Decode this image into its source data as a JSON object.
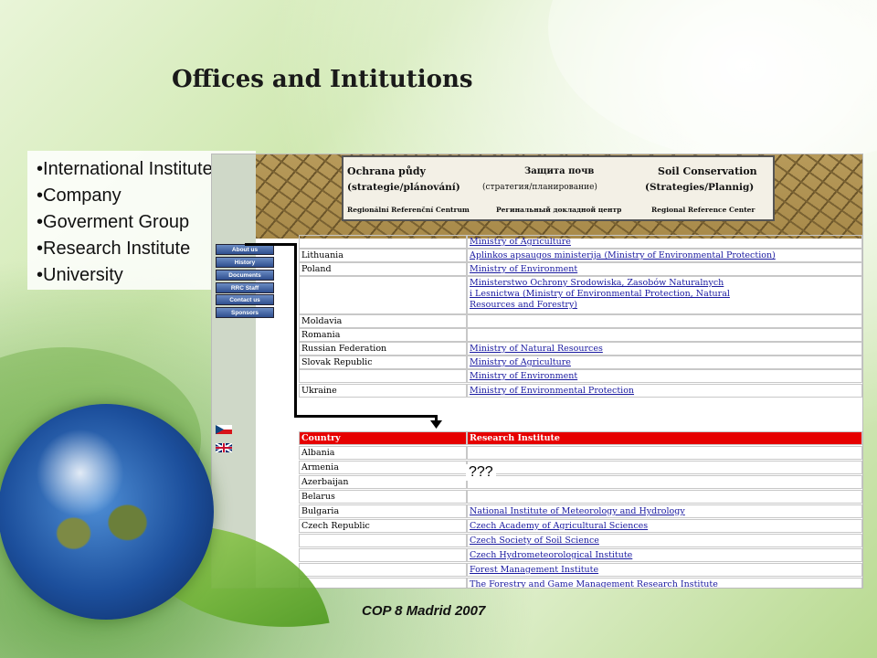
{
  "slide": {
    "title": "Offices and Intitutions",
    "bullets": [
      "International Institute",
      "Company",
      "Goverment Group",
      "Research Institute",
      "University"
    ],
    "footer": "COP 8 Madrid 2007",
    "question": "???"
  },
  "banner": {
    "cz_title": "Ochrana půdy",
    "cz_sub": "(strategie/plánování)",
    "cz_center": "Regionální Referenční Centrum",
    "ru_title": "Защита почв",
    "ru_sub": "(стратегия/планирование)",
    "ru_center": "Регинальный докладной центр",
    "en_title": "Soil Conservation",
    "en_sub": "(Strategies/Plannig)",
    "en_center": "Regional Reference Center"
  },
  "nav": [
    "About us",
    "History",
    "Documents",
    "RRC Staff",
    "Contact us",
    "Sponsors"
  ],
  "table1": {
    "rows": [
      {
        "country": "",
        "value": "Ministry of Agriculture"
      },
      {
        "country": "Lithuania",
        "value": "Aplinkos apsaugos ministerija (Ministry of Environmental Protection)"
      },
      {
        "country": "Poland",
        "value": "Ministry of Environment"
      },
      {
        "country": "",
        "value": "Ministerstwo Ochrony Srodowiska, Zasobów Naturalnych"
      },
      {
        "country": "",
        "value": "i Lesnictwa (Ministry of Environmental Protection, Natural"
      },
      {
        "country": "",
        "value": "Resources and Forestry)"
      },
      {
        "country": "Moldavia",
        "value": ""
      },
      {
        "country": "Romania",
        "value": ""
      },
      {
        "country": "Russian Federation",
        "value": "Ministry of Natural Resources"
      },
      {
        "country": "Slovak Republic",
        "value": "Ministry of Agriculture"
      },
      {
        "country": "",
        "value": "Ministry of  Environment"
      },
      {
        "country": "Ukraine",
        "value": "Ministry of Environmental Protection"
      }
    ]
  },
  "table2": {
    "header": {
      "country": "Country",
      "value": "Research Institute"
    },
    "rows": [
      {
        "country": "Albania",
        "value": ""
      },
      {
        "country": "Armenia",
        "value": ""
      },
      {
        "country": "Azerbaijan",
        "value": ""
      },
      {
        "country": "Belarus",
        "value": ""
      },
      {
        "country": "Bulgaria",
        "value": "National Institute of Meteorology and Hydrology"
      },
      {
        "country": "Czech Republic",
        "value": "Czech Academy of Agricultural Sciences"
      },
      {
        "country": "",
        "value": "Czech Society of Soil Science"
      },
      {
        "country": "",
        "value": "Czech Hydrometeorological Institute"
      },
      {
        "country": "",
        "value": "Forest Management Institute"
      },
      {
        "country": "",
        "value": "The Forestry and Game Management Research Institute"
      }
    ]
  }
}
